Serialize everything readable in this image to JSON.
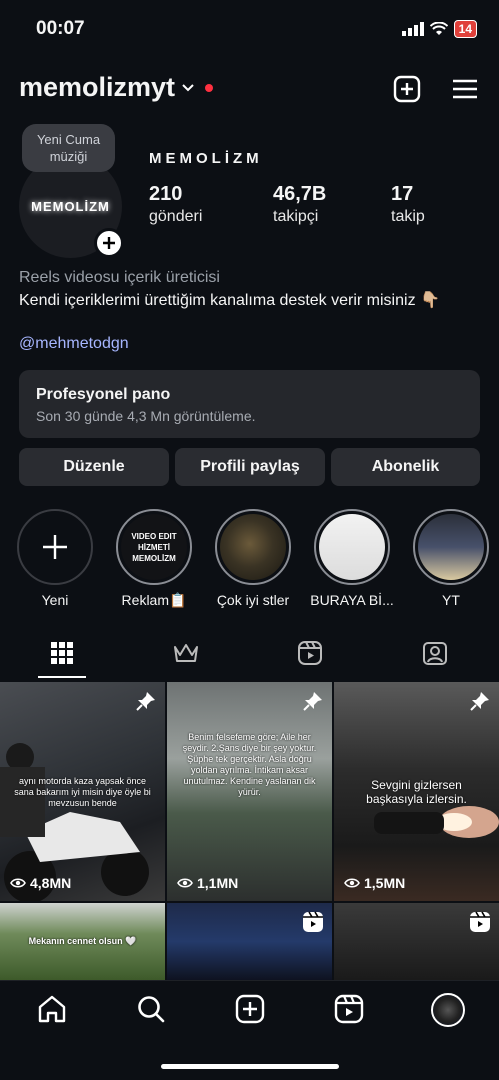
{
  "status_bar": {
    "time": "00:07",
    "battery": "14"
  },
  "header": {
    "username": "memolizmyt"
  },
  "profile": {
    "note": "Yeni Cuma müziği",
    "avatar_text": "MEMOLİZM",
    "display_name": "MEMOLİZM",
    "stats": [
      {
        "value": "210",
        "label": "gönderi"
      },
      {
        "value": "46,7B",
        "label": "takipçi"
      },
      {
        "value": "17",
        "label": "takip"
      }
    ],
    "category": "Reels videosu içerik üreticisi",
    "bio": "Kendi içeriklerimi ürettiğim kanalıma destek verir misiniz 👇🏼",
    "link": "@mehmetodgn"
  },
  "professional_panel": {
    "title": "Profesyonel pano",
    "subtitle": "Son 30 günde 4,3 Mn görüntüleme."
  },
  "actions": [
    "Düzenle",
    "Profili paylaş",
    "Abonelik"
  ],
  "highlights": [
    {
      "label": "Yeni",
      "cover_text": ""
    },
    {
      "label": "Reklam📋",
      "cover_text": "VIDEO EDIT HİZMETİ MEMOLİZM"
    },
    {
      "label": "Çok iyi stler",
      "cover_text": ""
    },
    {
      "label": "BURAYA Bİ...",
      "cover_text": ""
    },
    {
      "label": "YT",
      "cover_text": ""
    }
  ],
  "tabs": [
    "grid-icon",
    "crown-icon",
    "reels-icon",
    "tagged-icon"
  ],
  "posts": [
    {
      "caption": "aynı motorda kaza yapsak önce sana bakarım iyi misin diye öyle bi mevzusun bende",
      "views": "4,8MN",
      "pinned": true
    },
    {
      "caption": "Benim felsefeme göre; Aile her şeydir. 2.Şans diye bir şey yoktur. Şüphe tek gerçektir. Asla doğru yoldan ayrılma. İntikam aksar unutulmaz. Kendine yaslanan dik yürür.",
      "views": "1,1MN",
      "pinned": true
    },
    {
      "caption": "Sevgini gizlersen başkasıyla izlersin.",
      "views": "1,5MN",
      "pinned": true
    },
    {
      "caption": "Mekanın cennet olsun 🤍",
      "views": "",
      "pinned": false
    },
    {
      "caption": "",
      "views": "",
      "pinned": false
    },
    {
      "caption": "",
      "views": "",
      "pinned": false
    }
  ],
  "nav": [
    "home-icon",
    "search-icon",
    "create-icon",
    "reels-icon",
    "profile-avatar"
  ],
  "colors": {
    "background": "#0c0f14",
    "link": "#a7b6ff",
    "notification": "#ff3040"
  }
}
